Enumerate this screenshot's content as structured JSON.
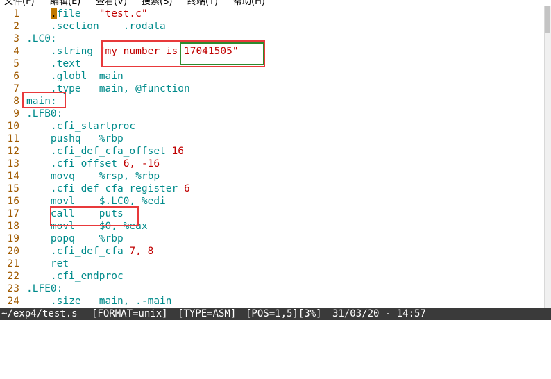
{
  "menu": [
    "文件(F)",
    "编辑(E)",
    "查看(V)",
    "搜索(S)",
    "终端(T)",
    "帮助(H)"
  ],
  "lines": [
    {
      "n": "1",
      "segs": [
        {
          "t": "    "
        },
        {
          "t": ".",
          "c": "cursor"
        },
        {
          "t": "file   ",
          "c": "kw"
        },
        {
          "t": "\"test.c\"",
          "c": "str"
        }
      ]
    },
    {
      "n": "2",
      "segs": [
        {
          "t": "    .section    .rodata",
          "c": "kw"
        }
      ]
    },
    {
      "n": "3",
      "segs": [
        {
          "t": ".LC0:",
          "c": "kw"
        }
      ]
    },
    {
      "n": "4",
      "segs": [
        {
          "t": "    .string ",
          "c": "kw"
        },
        {
          "t": "\"my number is 17041505\"",
          "c": "str"
        }
      ]
    },
    {
      "n": "5",
      "segs": [
        {
          "t": "    .text",
          "c": "kw"
        }
      ]
    },
    {
      "n": "6",
      "segs": [
        {
          "t": "    .globl  main",
          "c": "kw"
        }
      ]
    },
    {
      "n": "7",
      "segs": [
        {
          "t": "    .type   main, @function",
          "c": "kw"
        }
      ]
    },
    {
      "n": "8",
      "segs": [
        {
          "t": "main:",
          "c": "kw"
        }
      ]
    },
    {
      "n": "9",
      "segs": [
        {
          "t": ".LFB0:",
          "c": "kw"
        }
      ]
    },
    {
      "n": "10",
      "segs": [
        {
          "t": "    .cfi_startproc",
          "c": "kw"
        }
      ]
    },
    {
      "n": "11",
      "segs": [
        {
          "t": "    pushq   %rbp",
          "c": "kw"
        }
      ]
    },
    {
      "n": "12",
      "segs": [
        {
          "t": "    .cfi_def_cfa_offset ",
          "c": "kw"
        },
        {
          "t": "16",
          "c": "num"
        }
      ]
    },
    {
      "n": "13",
      "segs": [
        {
          "t": "    .cfi_offset ",
          "c": "kw"
        },
        {
          "t": "6, -16",
          "c": "num"
        }
      ]
    },
    {
      "n": "14",
      "segs": [
        {
          "t": "    movq    %rsp, %rbp",
          "c": "kw"
        }
      ]
    },
    {
      "n": "15",
      "segs": [
        {
          "t": "    .cfi_def_cfa_register ",
          "c": "kw"
        },
        {
          "t": "6",
          "c": "num"
        }
      ]
    },
    {
      "n": "16",
      "segs": [
        {
          "t": "    movl    $.LC0, %edi",
          "c": "kw"
        }
      ]
    },
    {
      "n": "17",
      "segs": [
        {
          "t": "    call    puts",
          "c": "kw"
        }
      ]
    },
    {
      "n": "18",
      "segs": [
        {
          "t": "    movl    $0, %eax",
          "c": "kw"
        }
      ]
    },
    {
      "n": "19",
      "segs": [
        {
          "t": "    popq    %rbp",
          "c": "kw"
        }
      ]
    },
    {
      "n": "20",
      "segs": [
        {
          "t": "    .cfi_def_cfa ",
          "c": "kw"
        },
        {
          "t": "7, 8",
          "c": "num"
        }
      ]
    },
    {
      "n": "21",
      "segs": [
        {
          "t": "    ret",
          "c": "kw"
        }
      ]
    },
    {
      "n": "22",
      "segs": [
        {
          "t": "    .cfi_endproc",
          "c": "kw"
        }
      ]
    },
    {
      "n": "23",
      "segs": [
        {
          "t": ".LFE0:",
          "c": "kw"
        }
      ]
    },
    {
      "n": "24",
      "segs": [
        {
          "t": "    .size   main, .-main",
          "c": "kw"
        }
      ]
    }
  ],
  "status": {
    "file": "~/exp4/test.s",
    "format": "[FORMAT=unix]",
    "type": "[TYPE=ASM]",
    "pos": "[POS=1,5][3%]",
    "datetime": "31/03/20 - 14:57"
  }
}
